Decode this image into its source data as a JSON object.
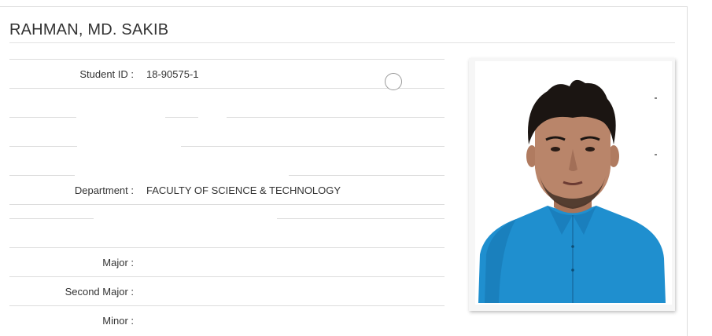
{
  "student": {
    "name": "RAHMAN, MD. SAKIB"
  },
  "fields": [
    {
      "label": "Student ID :",
      "value": "18-90575-1"
    },
    {
      "label": "",
      "value": ""
    },
    {
      "label": "",
      "value": ""
    },
    {
      "label": "",
      "value": ""
    },
    {
      "label": "Department :",
      "value": "FACULTY OF SCIENCE & TECHNOLOGY"
    },
    {
      "label": "",
      "value": ""
    },
    {
      "label": "Major :",
      "value": ""
    },
    {
      "label": "Second Major :",
      "value": ""
    },
    {
      "label": "Minor :",
      "value": ""
    }
  ],
  "colors": {
    "shirt": "#1e8fd0",
    "background": "#ffffff",
    "border": "#dddddd"
  },
  "icons": {
    "photo": "student-photo",
    "radio": "radio-circle-icon"
  }
}
